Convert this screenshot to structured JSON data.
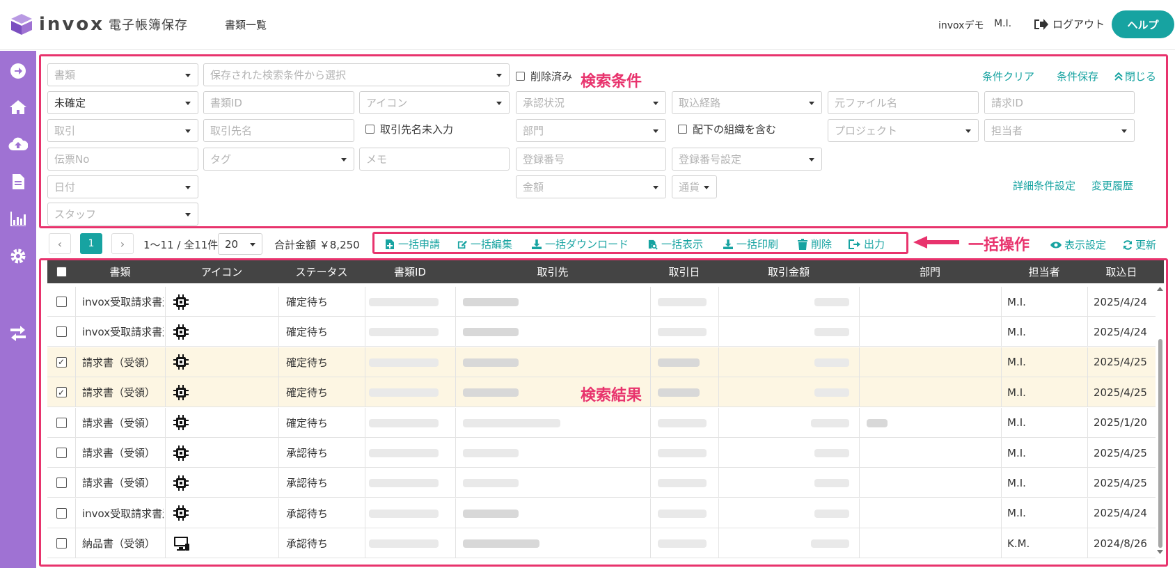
{
  "header": {
    "logo_word": "invox",
    "logo_sub": "電子帳簿保存",
    "nav_docs": "書類一覧",
    "company": "invoxデモ",
    "user": "M.I.",
    "logout": "ログアウト",
    "help": "ヘルプ"
  },
  "colors": {
    "accent": "#17a3a1",
    "sidebar": "#9f72d3",
    "annotation": "#e8336d",
    "header_bg": "#444444",
    "selected_row": "#fdf6e3"
  },
  "sidebar": {
    "icons": [
      "arrow-right-circle-icon",
      "home-icon",
      "cloud-upload-icon",
      "document-icon",
      "chart-icon",
      "gear-icon",
      "transfer-icon"
    ]
  },
  "search": {
    "doc_type": "書類",
    "saved_condition": "保存された検索条件から選択",
    "deleted": "削除済み",
    "annotation": "検索条件",
    "clear": "条件クリア",
    "save": "条件保存",
    "close": "閉じる",
    "status_value": "未確定",
    "doc_id": "書類ID",
    "icon": "アイコン",
    "approval": "承認状況",
    "import_route": "取込経路",
    "source_file": "元ファイル名",
    "request_id": "請求ID",
    "deal": "取引",
    "partner_name": "取引先名",
    "partner_empty": "取引先名未入力",
    "department": "部門",
    "include_sub": "配下の組織を含む",
    "project": "プロジェクト",
    "person": "担当者",
    "slip_no": "伝票No",
    "tag": "タグ",
    "memo": "メモ",
    "reg_no": "登録番号",
    "reg_setting": "登録番号設定",
    "date": "日付",
    "amount": "金額",
    "currency": "通貨",
    "detail": "詳細条件設定",
    "history": "変更履歴",
    "staff": "スタッフ"
  },
  "toolbar": {
    "prev": "‹",
    "page": "1",
    "next": "›",
    "count": "1〜11 / 全11件",
    "per_page": "20",
    "total": "合計金額 ￥8,250",
    "bulk_apply": "一括申請",
    "bulk_edit": "一括編集",
    "bulk_download": "一括ダウンロード",
    "bulk_view": "一括表示",
    "bulk_print": "一括印刷",
    "delete": "削除",
    "export": "出力",
    "annotation": "一括操作",
    "display_settings": "表示設定",
    "refresh": "更新"
  },
  "table": {
    "headers": [
      "書類",
      "アイコン",
      "ステータス",
      "書類ID",
      "取引先",
      "取引日",
      "取引金額",
      "部門",
      "担当者",
      "取込日"
    ],
    "annotation": "検索結果",
    "rows": [
      {
        "checked": false,
        "doc": "invox受取請求書送付",
        "icon": "chip-icon",
        "status": "確定待ち",
        "person": "M.I.",
        "date": "2025/4/24"
      },
      {
        "checked": false,
        "doc": "invox受取請求書送付",
        "icon": "chip-icon",
        "status": "確定待ち",
        "person": "M.I.",
        "date": "2025/4/24"
      },
      {
        "checked": true,
        "doc": "請求書（受領）",
        "icon": "chip-icon",
        "status": "確定待ち",
        "person": "M.I.",
        "date": "2025/4/25"
      },
      {
        "checked": true,
        "doc": "請求書（受領）",
        "icon": "chip-icon",
        "status": "確定待ち",
        "person": "M.I.",
        "date": "2025/4/25"
      },
      {
        "checked": false,
        "doc": "請求書（受領）",
        "icon": "chip-icon",
        "status": "確定待ち",
        "person": "M.I.",
        "date": "2025/1/20"
      },
      {
        "checked": false,
        "doc": "請求書（受領）",
        "icon": "chip-icon",
        "status": "承認待ち",
        "person": "M.I.",
        "date": "2025/4/25"
      },
      {
        "checked": false,
        "doc": "請求書（受領）",
        "icon": "chip-icon",
        "status": "承認待ち",
        "person": "M.I.",
        "date": "2025/4/25"
      },
      {
        "checked": false,
        "doc": "invox受取請求書送付",
        "icon": "chip-icon",
        "status": "承認待ち",
        "person": "M.I.",
        "date": "2025/4/24"
      },
      {
        "checked": false,
        "doc": "納品書（受領）",
        "icon": "monitor-icon",
        "status": "承認待ち",
        "person": "K.M.",
        "date": "2024/8/26"
      }
    ]
  }
}
